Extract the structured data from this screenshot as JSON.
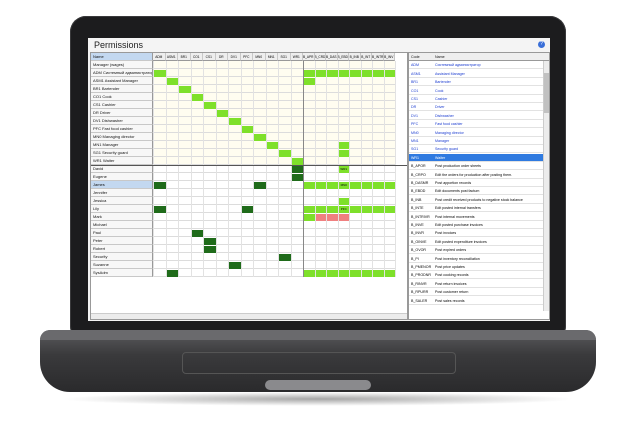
{
  "window": {
    "title": "Permissions",
    "help_icon": "question-icon"
  },
  "left": {
    "columns": [
      "Name",
      "ADM",
      "ASM1",
      "BR1",
      "CO1",
      "CS1",
      "DR",
      "DV1",
      "PFC",
      "MN0",
      "MN1",
      "SG1",
      "WR1",
      "B_APR",
      "B_CRD",
      "B_DAS",
      "B_EBD",
      "B_INB",
      "B_INT",
      "B_INTR",
      "B_INV"
    ],
    "roles": [
      "Manager (wages)",
      "ADM Системный администратор",
      "ASM1 Assistant Manager",
      "BR1 Bartender",
      "CO1 Cook",
      "CS1 Cashier",
      "DR Driver",
      "DV1 Dishwasher",
      "PFC Fast food cashier",
      "MN0 Managing director",
      "MN1 Manager",
      "SG1 Security guard",
      "WR1 Waiter"
    ],
    "users": [
      "David",
      "Eugene",
      "James",
      "Jennifer",
      "Jessica",
      "Lily",
      "Mark",
      "Michael",
      "Paul",
      "Peter",
      "Robert",
      "Security",
      "Suzanne",
      "SysAdm"
    ],
    "cell_labels": {
      "david": "WR1",
      "james": "MN0",
      "lily": "PFC"
    }
  },
  "right": {
    "header": {
      "code": "Code",
      "name": "Name"
    },
    "rows": [
      {
        "code": "ADM",
        "name": "Системный администратор",
        "blue": true
      },
      {
        "code": "ASM1",
        "name": "Assistant Manager",
        "blue": true
      },
      {
        "code": "BR1",
        "name": "Bartender",
        "blue": true
      },
      {
        "code": "CO1",
        "name": "Cook",
        "blue": true
      },
      {
        "code": "CS1",
        "name": "Cashier",
        "blue": true
      },
      {
        "code": "DR",
        "name": "Driver",
        "blue": true
      },
      {
        "code": "DV1",
        "name": "Dishwasher",
        "blue": true
      },
      {
        "code": "PFC",
        "name": "Fast food cashier",
        "blue": true
      },
      {
        "code": "MN0",
        "name": "Managing director",
        "blue": true
      },
      {
        "code": "MN1",
        "name": "Manager",
        "blue": true
      },
      {
        "code": "SG1",
        "name": "Security guard",
        "blue": true
      },
      {
        "code": "WR1",
        "name": "Waiter",
        "blue": false,
        "selected": true
      },
      {
        "code": "B_APOR",
        "name": "Post production order sheets"
      },
      {
        "code": "B_CRPO",
        "name": "Edit the orders for production after posting them."
      },
      {
        "code": "B_DASMR",
        "name": "Post apportion records"
      },
      {
        "code": "B_EBDD",
        "name": "Edit documents post factum"
      },
      {
        "code": "B_INB",
        "name": "Post credit received products to negative stock balance"
      },
      {
        "code": "B_INTE",
        "name": "Edit posted internal transfers"
      },
      {
        "code": "B_INTRIVR",
        "name": "Post internal movements"
      },
      {
        "code": "B_INVE",
        "name": "Edit posted purchase invoices"
      },
      {
        "code": "B_INVR",
        "name": "Post invoices"
      },
      {
        "code": "B_OINVE",
        "name": "Edit posted expenditure invoices"
      },
      {
        "code": "B_OVOR",
        "name": "Post expired orders"
      },
      {
        "code": "B_PI",
        "name": "Post inventory reconciliation"
      },
      {
        "code": "B_PMENOR",
        "name": "Post price updates"
      },
      {
        "code": "B_PRODNR",
        "name": "Post cooking records"
      },
      {
        "code": "B_RINVR",
        "name": "Post return invoices"
      },
      {
        "code": "B_RPURR",
        "name": "Post customer return"
      },
      {
        "code": "B_SALER",
        "name": "Post sales records"
      }
    ]
  },
  "colors": {
    "light_green": "#7ee02a",
    "dark_green": "#1f6b1a",
    "pink": "#f08080",
    "select_blue": "#2f7ae0",
    "grid_bg": "#fffdf0"
  }
}
